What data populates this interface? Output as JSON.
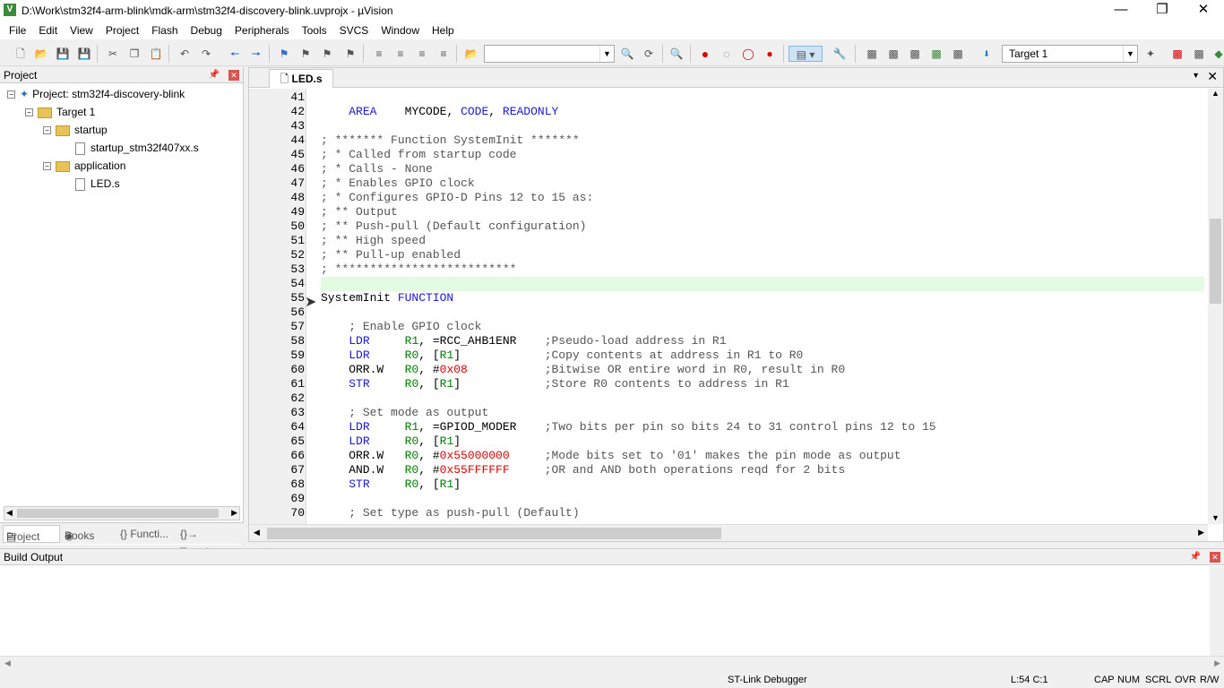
{
  "window": {
    "title": "D:\\Work\\stm32f4-arm-blink\\mdk-arm\\stm32f4-discovery-blink.uvprojx - µVision"
  },
  "menu": [
    "File",
    "Edit",
    "View",
    "Project",
    "Flash",
    "Debug",
    "Peripherals",
    "Tools",
    "SVCS",
    "Window",
    "Help"
  ],
  "toolbar": {
    "target": "Target 1"
  },
  "project_panel": {
    "title": "Project",
    "tree": [
      "Project: stm32f4-discovery-blink",
      "Target 1",
      "startup",
      "startup_stm32f407xx.s",
      "application",
      "LED.s"
    ],
    "tabs": [
      "Project",
      "Books",
      "{} Functi...",
      "{}→ Templa..."
    ]
  },
  "editor": {
    "tab": "LED.s",
    "lines": [
      {
        "n": "41",
        "t": ""
      },
      {
        "n": "42",
        "t": "    AREA    MYCODE, CODE, READONLY"
      },
      {
        "n": "43",
        "t": ""
      },
      {
        "n": "44",
        "t": "; ******* Function SystemInit *******"
      },
      {
        "n": "45",
        "t": "; * Called from startup code"
      },
      {
        "n": "46",
        "t": "; * Calls - None"
      },
      {
        "n": "47",
        "t": "; * Enables GPIO clock"
      },
      {
        "n": "48",
        "t": "; * Configures GPIO-D Pins 12 to 15 as:"
      },
      {
        "n": "49",
        "t": "; ** Output"
      },
      {
        "n": "50",
        "t": "; ** Push-pull (Default configuration)"
      },
      {
        "n": "51",
        "t": "; ** High speed"
      },
      {
        "n": "52",
        "t": "; ** Pull-up enabled"
      },
      {
        "n": "53",
        "t": "; **************************"
      },
      {
        "n": "54",
        "t": ""
      },
      {
        "n": "55",
        "t": "SystemInit FUNCTION"
      },
      {
        "n": "56",
        "t": ""
      },
      {
        "n": "57",
        "t": "    ; Enable GPIO clock"
      },
      {
        "n": "58",
        "t": "    LDR     R1, =RCC_AHB1ENR    ;Pseudo-load address in R1"
      },
      {
        "n": "59",
        "t": "    LDR     R0, [R1]            ;Copy contents at address in R1 to R0"
      },
      {
        "n": "60",
        "t": "    ORR.W   R0, #0x08           ;Bitwise OR entire word in R0, result in R0"
      },
      {
        "n": "61",
        "t": "    STR     R0, [R1]            ;Store R0 contents to address in R1"
      },
      {
        "n": "62",
        "t": ""
      },
      {
        "n": "63",
        "t": "    ; Set mode as output"
      },
      {
        "n": "64",
        "t": "    LDR     R1, =GPIOD_MODER    ;Two bits per pin so bits 24 to 31 control pins 12 to 15"
      },
      {
        "n": "65",
        "t": "    LDR     R0, [R1]"
      },
      {
        "n": "66",
        "t": "    ORR.W   R0, #0x55000000     ;Mode bits set to '01' makes the pin mode as output"
      },
      {
        "n": "67",
        "t": "    AND.W   R0, #0x55FFFFFF     ;OR and AND both operations reqd for 2 bits"
      },
      {
        "n": "68",
        "t": "    STR     R0, [R1]"
      },
      {
        "n": "69",
        "t": ""
      },
      {
        "n": "70",
        "t": "    ; Set type as push-pull (Default)"
      }
    ]
  },
  "build_output": {
    "title": "Build Output"
  },
  "status": {
    "debugger": "ST-Link Debugger",
    "position": "L:54 C:1",
    "flags": [
      "CAP",
      "NUM",
      "SCRL",
      "OVR",
      "R/W"
    ]
  },
  "colors": {
    "comment": "#555555",
    "keyword": "#1a1adb",
    "register": "#008000",
    "number": "#e00000",
    "current_line": "#e3fbe3"
  }
}
